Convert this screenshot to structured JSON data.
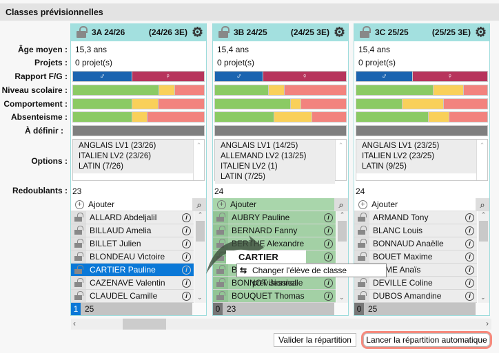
{
  "title": "Classes prévisionnelles",
  "labels": {
    "age": "Âge moyen :",
    "projets": "Projets :",
    "rapport": "Rapport F/G :",
    "niveau": "Niveau scolaire :",
    "comportement": "Comportement :",
    "absenteisme": "Absenteisme :",
    "a_definir": "À définir :",
    "options": "Options :",
    "redoublants": "Redoublants :"
  },
  "colors": {
    "male": "#1b64b0",
    "female": "#b7345c",
    "green": "#8bca64",
    "yellow": "#f9d05a",
    "red": "#f2837e",
    "grey": "#7f7f7f",
    "header": "#a3e0df",
    "selected": "#0a78d7"
  },
  "add_label": "Ajouter",
  "icons": {
    "male": "♂",
    "female": "♀"
  },
  "columns": [
    {
      "name": "3A 24/26",
      "summary": "(24/26 3E)",
      "age": "15,3 ans",
      "projets": "0 projet(s)",
      "rapport_male": 0.45,
      "niveau": [
        0.66,
        0.12,
        0.22
      ],
      "comportement": [
        0.45,
        0.2,
        0.35
      ],
      "absenteisme": [
        0.45,
        0.12,
        0.43
      ],
      "options": [
        "ANGLAIS LV1 (23/26)",
        "ITALIEN LV2 (23/26)",
        "LATIN (7/26)"
      ],
      "redoublants": "23",
      "students": [
        "ALLARD Abdeljalil",
        "BILLAUD Amelia",
        "BILLET Julien",
        "BLONDEAU Victoire",
        "CARTIER Pauline",
        "CAZENAVE Valentin",
        "CLAUDEL Camille"
      ],
      "selected_student": "CARTIER Pauline",
      "selected_count": "1",
      "total": "25",
      "highlight": false
    },
    {
      "name": "3B 24/25",
      "summary": "(24/25 3E)",
      "age": "15,4 ans",
      "projets": "0 projet(s)",
      "rapport_male": 0.37,
      "niveau": [
        0.41,
        0.12,
        0.47
      ],
      "comportement": [
        0.58,
        0.08,
        0.34
      ],
      "absenteisme": [
        0.45,
        0.29,
        0.26
      ],
      "options": [
        "ANGLAIS LV1 (14/25)",
        "ALLEMAND LV2 (13/25)",
        "ITALIEN LV2 (1)",
        "LATIN (7/25)"
      ],
      "redoublants": "24",
      "students": [
        "AUBRY Pauline",
        "BERNARD Fanny",
        "BERTHE Alexandre",
        "",
        "B",
        "BONNOT Jessica",
        "BOUQUET Thomas"
      ],
      "selected_student": "",
      "selected_count": "0",
      "total": "23",
      "highlight": true
    },
    {
      "name": "3C 25/25",
      "summary": "(25/25 3E)",
      "age": "15,4 ans",
      "projets": "0 projet(s)",
      "rapport_male": 0.43,
      "niveau": [
        0.59,
        0.23,
        0.18
      ],
      "comportement": [
        0.35,
        0.32,
        0.33
      ],
      "absenteisme": [
        0.55,
        0.16,
        0.29
      ],
      "options": [
        "ANGLAIS LV1 (23/25)",
        "ITALIEN LV2 (23/25)",
        "LATIN (9/25)"
      ],
      "redoublants": "24",
      "students": [
        "ARMAND Tony",
        "BLANC Louis",
        "BONNAUD Anaëlle",
        "BOUET Maxime",
        "ORME Anaïs",
        "DEVILLE Coline",
        "DUBOS Amandine"
      ],
      "selected_student": "",
      "selected_count": "0",
      "total": "25",
      "highlight": false
    }
  ],
  "drag": {
    "student": "CARTIER Pauline",
    "tooltip": "Changer l'élève de classe prévisionnelle"
  },
  "buttons": {
    "validate": "Valider la répartition",
    "auto": "Lancer la répartition automatique"
  }
}
